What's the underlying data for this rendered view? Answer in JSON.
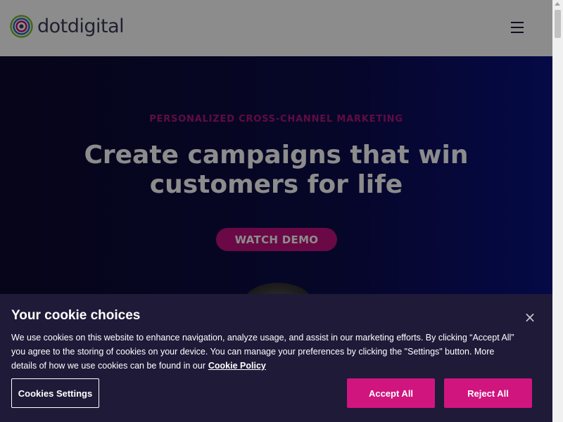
{
  "header": {
    "logo_text": "dotdigital"
  },
  "hero": {
    "eyebrow": "PERSONALIZED CROSS-CHANNEL MARKETING",
    "title": "Create campaigns that win customers for life",
    "cta_label": "WATCH DEMO"
  },
  "cookie_banner": {
    "title": "Your cookie choices",
    "close_icon": "×",
    "body_text": "We use cookies on this website to enhance navigation, analyze usage, and assist in our marketing efforts. By clicking “Accept All” you agree to the storing of cookies on your device. You can manage your preferences by clicking the \"Settings\" button. More details of how we use cookies can be found in our",
    "policy_link": "Cookie Policy",
    "settings_label": "Cookies Settings",
    "accept_label": "Accept All",
    "reject_label": "Reject All"
  },
  "colors": {
    "accent": "#d0157f",
    "banner_bg": "#1f1a38",
    "hero_bg": "#0b0b4a"
  }
}
